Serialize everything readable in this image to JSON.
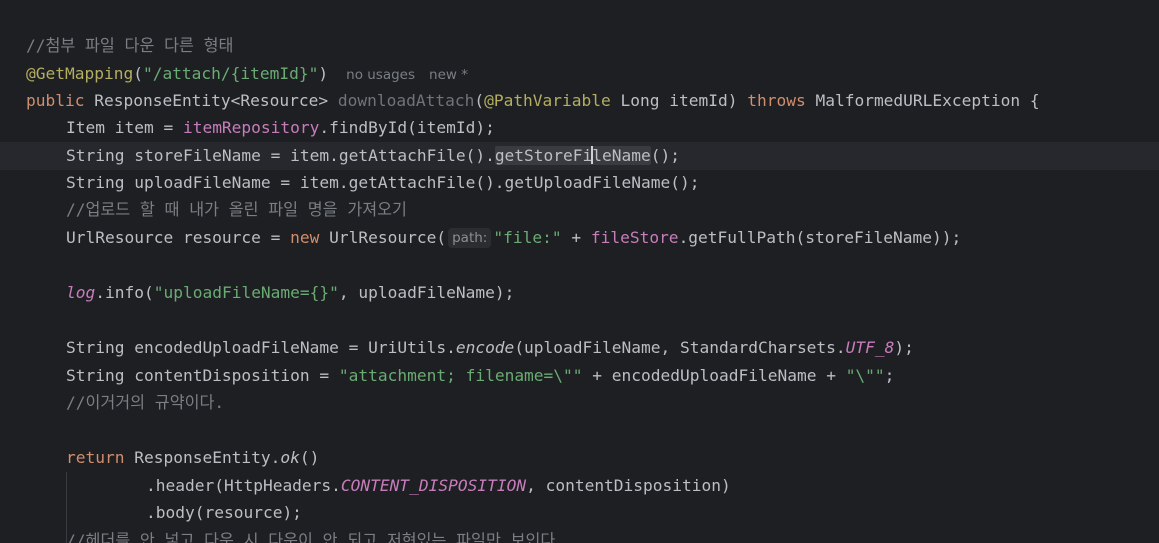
{
  "editor": {
    "lines": {
      "l1_comment": "//첨부 파일 다운 다른 형태",
      "l2_annotation": "@GetMapping",
      "l2_paren_open": "(",
      "l2_string": "\"/attach/{itemId}\"",
      "l2_paren_close": ")",
      "l2_hint_usages": "no usages",
      "l2_hint_new": "new *",
      "l3_public": "public",
      "l3_type": " ResponseEntity<Resource> ",
      "l3_method": "downloadAttach",
      "l3_paren": "(",
      "l3_param_ann": "@PathVariable",
      "l3_param": " Long itemId) ",
      "l3_throws": "throws",
      "l3_exc": " MalformedURLException {",
      "l4_a": "Item item = ",
      "l4_field": "itemRepository",
      "l4_b": ".findById(itemId);",
      "l5_a": "String storeFileName = item.getAttachFile().",
      "l5_sel_a": "getStoreFi",
      "l5_sel_b": "leName",
      "l5_b": "();",
      "l6": "String uploadFileName = item.getAttachFile().getUploadFileName();",
      "l7_comment": "//업로드 할 때 내가 올린 파일 명을 가져오기",
      "l8_a": "UrlResource resource = ",
      "l8_new": "new",
      "l8_b": " UrlResource(",
      "l8_inlay": "path:",
      "l8_str": "\"file:\"",
      "l8_c": " + ",
      "l8_field": "fileStore",
      "l8_d": ".getFullPath(storeFileName));",
      "l10_log": "log",
      "l10_a": ".info(",
      "l10_str": "\"uploadFileName={}\"",
      "l10_b": ", uploadFileName);",
      "l12_a": "String encodedUploadFileName = UriUtils.",
      "l12_encode": "encode",
      "l12_b": "(uploadFileName, StandardCharsets.",
      "l12_utf": "UTF_8",
      "l12_c": ");",
      "l13_a": "String contentDisposition = ",
      "l13_str1": "\"attachment; filename=\\\"\"",
      "l13_b": " + encodedUploadFileName + ",
      "l13_str2": "\"\\\"\"",
      "l13_c": ";",
      "l14_comment": "//이거거의 규약이다.",
      "l16_return": "return",
      "l16_a": " ResponseEntity.",
      "l16_ok": "ok",
      "l16_b": "()",
      "l17_a": ".header(HttpHeaders.",
      "l17_const": "CONTENT_DISPOSITION",
      "l17_b": ", contentDisposition)",
      "l18": ".body(resource);",
      "l19_comment": "//헤더를 안 넣고 다운 시 다운이 안 되고 저현있는 파일만 보인다"
    }
  },
  "colors": {
    "background": "#1e1f22",
    "current_line": "#26282e",
    "keyword": "#cf8e6d",
    "string": "#6aab73",
    "comment": "#7a7e85",
    "annotation": "#b3ae60",
    "field": "#c77dbb",
    "method_decl_unused": "#6f737a",
    "default_text": "#bcbec4"
  },
  "icons": {
    "gutter_intention": "lightbulb-icon"
  }
}
